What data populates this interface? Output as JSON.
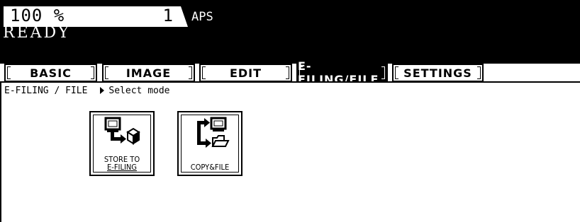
{
  "header": {
    "zoom": "100  %",
    "copies": "1",
    "paper_mode": "APS",
    "status": "READY"
  },
  "tabs": [
    {
      "label": "BASIC",
      "active": false
    },
    {
      "label": "IMAGE",
      "active": false
    },
    {
      "label": "EDIT",
      "active": false
    },
    {
      "label": "E-FILING/FILE",
      "active": true
    },
    {
      "label": "SETTINGS",
      "active": false
    }
  ],
  "content": {
    "section": "E-FILING / FILE",
    "instruction": "Select mode",
    "buttons": [
      {
        "line1": "STORE TO",
        "line2": "E-FILING",
        "icon": "store-to-efiling-icon"
      },
      {
        "line1": "",
        "line2": "COPY&FILE",
        "icon": "copy-and-file-icon"
      }
    ]
  }
}
